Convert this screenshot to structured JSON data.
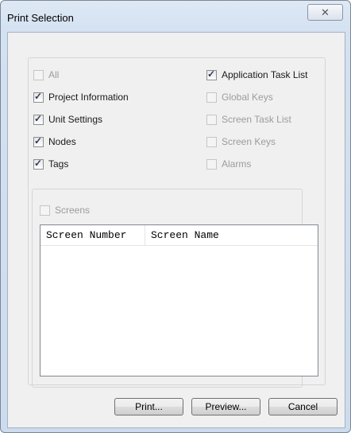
{
  "window": {
    "title": "Print Selection",
    "close_glyph": "✕"
  },
  "options": {
    "all": {
      "label": "All",
      "checked": false,
      "enabled": false
    },
    "project_information": {
      "label": "Project Information",
      "checked": true,
      "enabled": true
    },
    "unit_settings": {
      "label": "Unit Settings",
      "checked": true,
      "enabled": true
    },
    "nodes": {
      "label": "Nodes",
      "checked": true,
      "enabled": true
    },
    "tags": {
      "label": "Tags",
      "checked": true,
      "enabled": true
    },
    "application_task_list": {
      "label": "Application Task List",
      "checked": true,
      "enabled": true
    },
    "global_keys": {
      "label": "Global Keys",
      "checked": false,
      "enabled": false
    },
    "screen_task_list": {
      "label": "Screen Task List",
      "checked": false,
      "enabled": false
    },
    "screen_keys": {
      "label": "Screen Keys",
      "checked": false,
      "enabled": false
    },
    "alarms": {
      "label": "Alarms",
      "checked": false,
      "enabled": false
    }
  },
  "screens": {
    "checkbox": {
      "label": "Screens",
      "checked": false,
      "enabled": false
    },
    "columns": [
      "Screen Number",
      "Screen Name"
    ],
    "rows": []
  },
  "buttons": {
    "print": "Print...",
    "preview": "Preview...",
    "cancel": "Cancel"
  },
  "colors": {
    "accent": "#2d3c5b",
    "disabled_text": "#9c9c9c"
  }
}
